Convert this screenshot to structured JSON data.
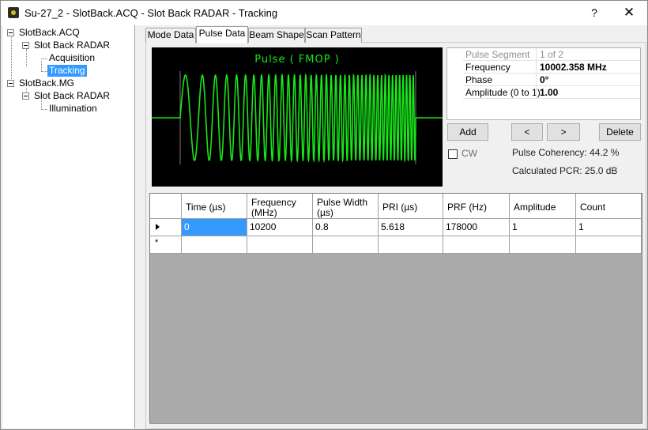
{
  "window": {
    "title": "Su-27_2 - SlotBack.ACQ - Slot Back RADAR - Tracking",
    "help": "?",
    "close": "✕"
  },
  "tree": {
    "items": [
      {
        "label": "SlotBack.ACQ"
      },
      {
        "label": "Slot Back RADAR"
      },
      {
        "label": "Acquisition"
      },
      {
        "label": "Tracking",
        "selected": true
      },
      {
        "label": "SlotBack.MG"
      },
      {
        "label": "Slot Back RADAR"
      },
      {
        "label": "Illumination"
      }
    ]
  },
  "tabs": [
    {
      "label": "Mode Data"
    },
    {
      "label": "Pulse Data",
      "active": true
    },
    {
      "label": "Beam Shape"
    },
    {
      "label": "Scan Pattern"
    }
  ],
  "scope": {
    "title": "Pulse ( FMOP )",
    "trace_color": "#19e619"
  },
  "segment": {
    "header_key": "Pulse Segment",
    "header_value": "1 of 2",
    "rows": [
      {
        "key": "Frequency",
        "value": "10002.358 MHz"
      },
      {
        "key": "Phase",
        "value": "0°"
      },
      {
        "key": "Amplitude (0 to 1)",
        "value": "1.00"
      }
    ]
  },
  "buttons": {
    "add": "Add",
    "prev": "<",
    "next": ">",
    "delete": "Delete"
  },
  "cw_label": "CW",
  "info": {
    "coherency": "Pulse Coherency: 44.2 %",
    "pcr": "Calculated PCR: 25.0 dB"
  },
  "grid": {
    "columns": [
      "Time (µs)",
      "Frequency (MHz)",
      "Pulse Width (µs)",
      "PRI (µs)",
      "PRF (Hz)",
      "Amplitude",
      "Count"
    ],
    "rows": [
      [
        "0",
        "10200",
        "0.8",
        "5.618",
        "178000",
        "1",
        "1"
      ]
    ],
    "new_row_marker": "*"
  }
}
